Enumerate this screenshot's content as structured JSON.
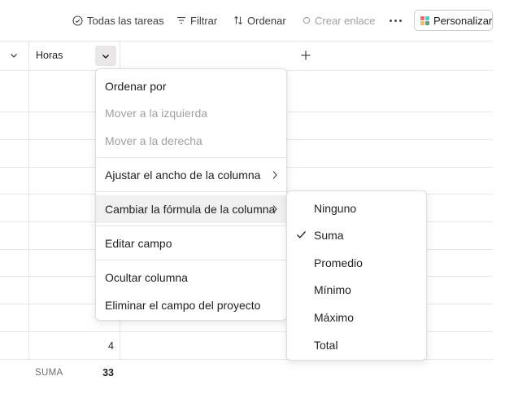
{
  "toolbar": {
    "all_tasks_label": "Todas las tareas",
    "filter_label": "Filtrar",
    "sort_label": "Ordenar",
    "create_link_label": "Crear enlace",
    "customize_label": "Personalizar"
  },
  "column": {
    "header_label": "Horas",
    "visible_values": [
      "4"
    ],
    "summary_label": "SUMA",
    "summary_value": "33"
  },
  "column_menu": {
    "items": [
      {
        "label": "Ordenar por",
        "disabled": false
      },
      {
        "label": "Mover a la izquierda",
        "disabled": true
      },
      {
        "label": "Mover a la derecha",
        "disabled": true
      },
      {
        "label": "Ajustar el ancho de la columna",
        "disabled": false,
        "has_submenu": true
      },
      {
        "label": "Cambiar la fórmula de la columna",
        "disabled": false,
        "has_submenu": true,
        "active": true
      },
      {
        "label": "Editar campo",
        "disabled": false
      },
      {
        "label": "Ocultar columna",
        "disabled": false
      },
      {
        "label": "Eliminar el campo del proyecto",
        "disabled": false
      }
    ]
  },
  "formula_menu": {
    "selected": "Suma",
    "items": [
      {
        "label": "Ninguno"
      },
      {
        "label": "Suma"
      },
      {
        "label": "Promedio"
      },
      {
        "label": "Mínimo"
      },
      {
        "label": "Máximo"
      },
      {
        "label": "Total"
      }
    ]
  },
  "colors": {
    "palette": [
      "#f06a6a",
      "#4ecbc4",
      "#f1bd6c",
      "#5da283"
    ],
    "active_item_bg": "#f1f0f0"
  }
}
